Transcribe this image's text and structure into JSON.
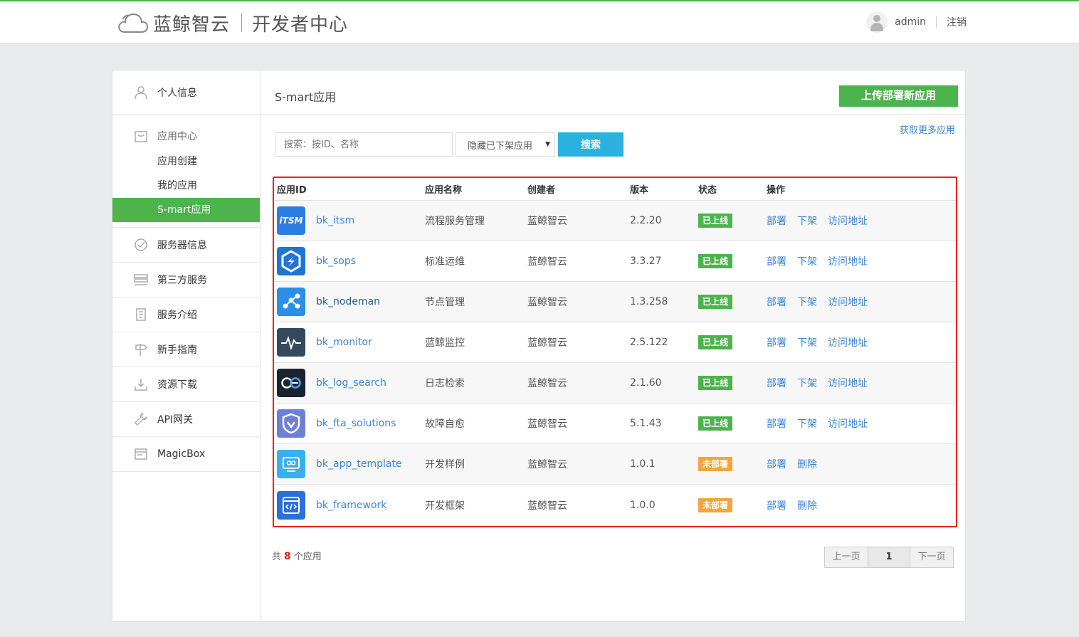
{
  "header": {
    "brand": "蓝鲸智云",
    "subtitle": "开发者中心",
    "username": "admin",
    "logout": "注销"
  },
  "sidebar": {
    "profile": "个人信息",
    "app_center": "应用中心",
    "app_create": "应用创建",
    "my_apps": "我的应用",
    "smart_apps": "S-mart应用",
    "server_info": "服务器信息",
    "third_party": "第三方服务",
    "service_intro": "服务介绍",
    "newbie_guide": "新手指南",
    "downloads": "资源下载",
    "api_gateway": "API网关",
    "magicbox": "MagicBox"
  },
  "main": {
    "title": "S-mart应用",
    "upload_button": "上传部署新应用",
    "more_link": "获取更多应用",
    "search_placeholder": "搜索：按ID、名称",
    "filter_value": "隐藏已下架应用",
    "search_button": "搜索"
  },
  "table": {
    "headers": {
      "id": "应用ID",
      "name": "应用名称",
      "creator": "创建者",
      "version": "版本",
      "status": "状态",
      "ops": "操作"
    },
    "rows": [
      {
        "id": "bk_itsm",
        "name": "流程服务管理",
        "creator": "蓝鲸智云",
        "version": "2.2.20",
        "status": "已上线",
        "ops": [
          "部署",
          "下架",
          "访问地址"
        ],
        "icon": "itsm-icon",
        "icon_text": "iTSM"
      },
      {
        "id": "bk_sops",
        "name": "标准运维",
        "creator": "蓝鲸智云",
        "version": "3.3.27",
        "status": "已上线",
        "ops": [
          "部署",
          "下架",
          "访问地址"
        ],
        "icon": "sops-icon"
      },
      {
        "id": "bk_nodeman",
        "name": "节点管理",
        "creator": "蓝鲸智云",
        "version": "1.3.258",
        "status": "已上线",
        "ops": [
          "部署",
          "下架",
          "访问地址"
        ],
        "icon": "nodeman-icon"
      },
      {
        "id": "bk_monitor",
        "name": "蓝鲸监控",
        "creator": "蓝鲸智云",
        "version": "2.5.122",
        "status": "已上线",
        "ops": [
          "部署",
          "下架",
          "访问地址"
        ],
        "icon": "monitor-icon"
      },
      {
        "id": "bk_log_search",
        "name": "日志检索",
        "creator": "蓝鲸智云",
        "version": "2.1.60",
        "status": "已上线",
        "ops": [
          "部署",
          "下架",
          "访问地址"
        ],
        "icon": "log-search-icon"
      },
      {
        "id": "bk_fta_solutions",
        "name": "故障自愈",
        "creator": "蓝鲸智云",
        "version": "5.1.43",
        "status": "已上线",
        "ops": [
          "部署",
          "下架",
          "访问地址"
        ],
        "icon": "fta-icon"
      },
      {
        "id": "bk_app_template",
        "name": "开发样例",
        "creator": "蓝鲸智云",
        "version": "1.0.1",
        "status": "未部署",
        "ops": [
          "部署",
          "删除"
        ],
        "icon": "app-template-icon"
      },
      {
        "id": "bk_framework",
        "name": "开发框架",
        "creator": "蓝鲸智云",
        "version": "1.0.0",
        "status": "未部署",
        "ops": [
          "部署",
          "删除"
        ],
        "icon": "framework-icon"
      }
    ]
  },
  "footer": {
    "total_prefix": "共",
    "total_count": "8",
    "total_suffix": "个应用",
    "prev": "上一页",
    "page": "1",
    "next": "下一页"
  },
  "colors": {
    "primary_green": "#4db34d",
    "search_blue": "#2ab1e0",
    "link_blue": "#3a84d7",
    "highlight_red": "#e8231a",
    "pending_orange": "#f0a63a"
  }
}
